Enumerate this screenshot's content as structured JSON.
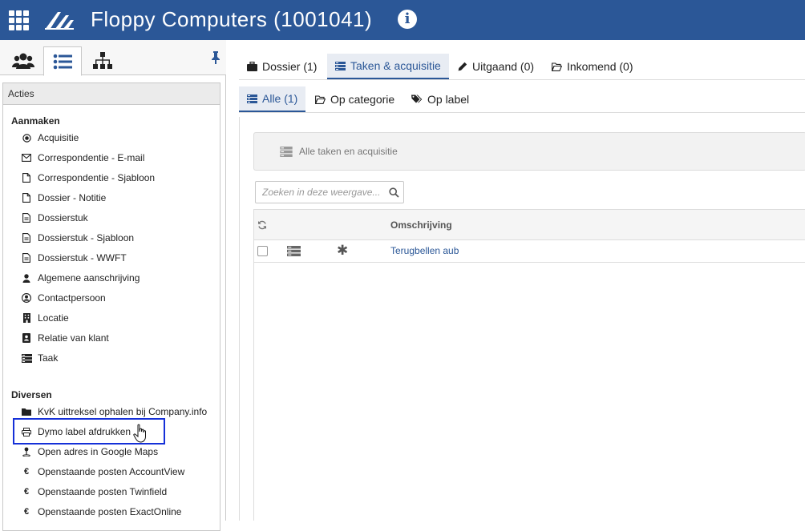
{
  "header": {
    "title": "Floppy Computers (1001041)",
    "apps_icon": "grid-icon",
    "logo_icon": "logo-icon",
    "info_icon": "info-icon",
    "background": "#2b5797"
  },
  "sidebar": {
    "tabs": [
      {
        "icon": "users-icon",
        "active": false
      },
      {
        "icon": "list-icon",
        "active": true
      },
      {
        "icon": "hierarchy-icon",
        "active": false
      }
    ],
    "pin_icon": "pin-icon",
    "panel_title": "Acties",
    "groups": [
      {
        "title": "Aanmaken",
        "items": [
          {
            "label": "Acquisitie",
            "icon": "target-icon"
          },
          {
            "label": "Correspondentie - E-mail",
            "icon": "envelope-icon"
          },
          {
            "label": "Correspondentie - Sjabloon",
            "icon": "file-icon"
          },
          {
            "label": "Dossier - Notitie",
            "icon": "file-icon"
          },
          {
            "label": "Dossierstuk",
            "icon": "file-text-icon"
          },
          {
            "label": "Dossierstuk - Sjabloon",
            "icon": "file-text-icon"
          },
          {
            "label": "Dossierstuk - WWFT",
            "icon": "file-text-icon"
          },
          {
            "label": "Algemene aanschrijving",
            "icon": "user-icon"
          },
          {
            "label": "Contactpersoon",
            "icon": "user-circle-icon"
          },
          {
            "label": "Locatie",
            "icon": "building-icon"
          },
          {
            "label": "Relatie van klant",
            "icon": "contact-card-icon"
          },
          {
            "label": "Taak",
            "icon": "tasks-icon"
          }
        ]
      },
      {
        "title": "Diversen",
        "items": [
          {
            "label": "KvK uittreksel ophalen bij Company.info",
            "icon": "folder-icon"
          },
          {
            "label": "Dymo label afdrukken",
            "icon": "print-icon"
          },
          {
            "label": "Open adres in Google Maps",
            "icon": "map-pin-icon"
          },
          {
            "label": "Openstaande posten AccountView",
            "icon": "euro-icon"
          },
          {
            "label": "Openstaande posten Twinfield",
            "icon": "euro-icon"
          },
          {
            "label": "Openstaande posten ExactOnline",
            "icon": "euro-icon"
          }
        ]
      }
    ]
  },
  "main": {
    "tabs": [
      {
        "label": "Dossier (1)",
        "icon": "briefcase-icon",
        "active": false
      },
      {
        "label": "Taken & acquisitie",
        "icon": "tasks-icon",
        "active": true
      },
      {
        "label": "Uitgaand (0)",
        "icon": "pencil-icon",
        "active": false
      },
      {
        "label": "Inkomend (0)",
        "icon": "folder-open-icon",
        "active": false
      }
    ],
    "subtabs": [
      {
        "label": "Alle (1)",
        "icon": "tasks-icon",
        "active": true
      },
      {
        "label": "Op categorie",
        "icon": "folder-open-icon",
        "active": false
      },
      {
        "label": "Op label",
        "icon": "tags-icon",
        "active": false
      }
    ],
    "view_title": "Alle taken en acquisitie",
    "search": {
      "placeholder": "Zoeken in deze weergave...",
      "value": ""
    },
    "table": {
      "columns": [
        "",
        "",
        "",
        "Omschrijving"
      ],
      "rows": [
        {
          "type_icon": "tasks-icon",
          "status_icon": "asterisk-icon",
          "description": "Terugbellen aub"
        }
      ]
    }
  },
  "colors": {
    "brand": "#2b5797",
    "highlight": "#1530d8",
    "link": "#2b5797"
  }
}
